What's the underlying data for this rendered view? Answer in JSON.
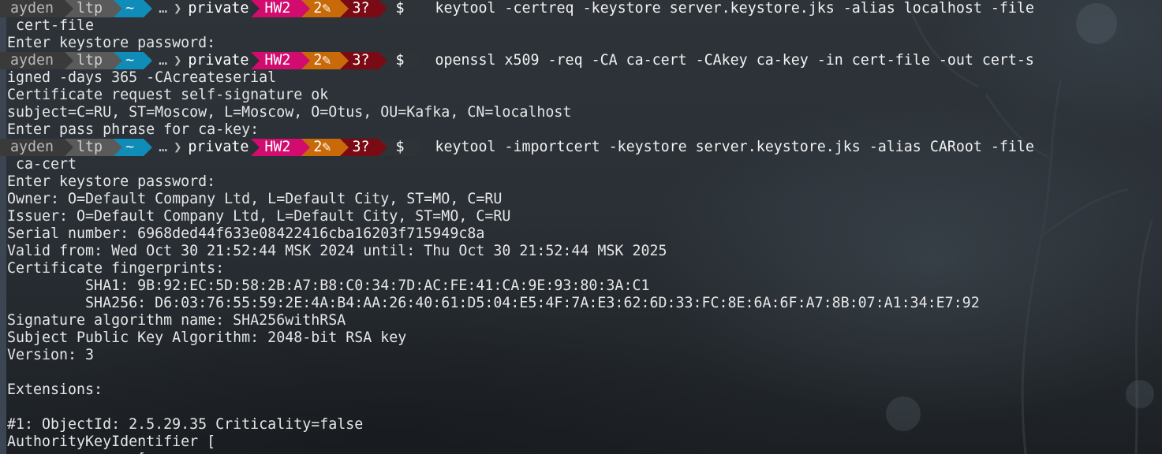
{
  "prompt": {
    "user": "ayden",
    "host": "ltp",
    "home": "~",
    "ellipsis": "…",
    "directory": "private",
    "branch": "HW2",
    "modified": "2✎",
    "untracked": "3?",
    "symbol": "$",
    "icons": {
      "separator": "chevron-right-icon",
      "modified": "pencil-icon"
    }
  },
  "lines": [
    {
      "type": "prompt",
      "command": "keytool -certreq -keystore server.keystore.jks -alias localhost -file"
    },
    {
      "type": "out",
      "text": " cert-file"
    },
    {
      "type": "out",
      "text": "Enter keystore password:"
    },
    {
      "type": "prompt",
      "command": "openssl x509 -req -CA ca-cert -CAkey ca-key -in cert-file -out cert-s"
    },
    {
      "type": "out",
      "text": "igned -days 365 -CAcreateserial"
    },
    {
      "type": "out",
      "text": "Certificate request self-signature ok"
    },
    {
      "type": "out",
      "text": "subject=C=RU, ST=Moscow, L=Moscow, O=Otus, OU=Kafka, CN=localhost"
    },
    {
      "type": "out",
      "text": "Enter pass phrase for ca-key:"
    },
    {
      "type": "prompt",
      "command": "keytool -importcert -keystore server.keystore.jks -alias CARoot -file"
    },
    {
      "type": "out",
      "text": " ca-cert"
    },
    {
      "type": "out",
      "text": "Enter keystore password:"
    },
    {
      "type": "out",
      "text": "Owner: O=Default Company Ltd, L=Default City, ST=MO, C=RU"
    },
    {
      "type": "out",
      "text": "Issuer: O=Default Company Ltd, L=Default City, ST=MO, C=RU"
    },
    {
      "type": "out",
      "text": "Serial number: 6968ded44f633e08422416cba16203f715949c8a"
    },
    {
      "type": "out",
      "text": "Valid from: Wed Oct 30 21:52:44 MSK 2024 until: Thu Oct 30 21:52:44 MSK 2025"
    },
    {
      "type": "out",
      "text": "Certificate fingerprints:"
    },
    {
      "type": "out",
      "text": "         SHA1: 9B:92:EC:5D:58:2B:A7:B8:C0:34:7D:AC:FE:41:CA:9E:93:80:3A:C1"
    },
    {
      "type": "out",
      "text": "         SHA256: D6:03:76:55:59:2E:4A:B4:AA:26:40:61:D5:04:E5:4F:7A:E3:62:6D:33:FC:8E:6A:6F:A7:8B:07:A1:34:E7:92"
    },
    {
      "type": "out",
      "text": "Signature algorithm name: SHA256withRSA"
    },
    {
      "type": "out",
      "text": "Subject Public Key Algorithm: 2048-bit RSA key"
    },
    {
      "type": "out",
      "text": "Version: 3"
    },
    {
      "type": "out",
      "text": ""
    },
    {
      "type": "out",
      "text": "Extensions:"
    },
    {
      "type": "out",
      "text": ""
    },
    {
      "type": "out",
      "text": "#1: ObjectId: 2.5.29.35 Criticality=false"
    },
    {
      "type": "out",
      "text": "AuthorityKeyIdentifier ["
    },
    {
      "type": "out",
      "text": "               ["
    }
  ],
  "colors": {
    "user_bg": "#3a3a3a",
    "host_bg": "#5a5a5a",
    "home_bg": "#0f8db8",
    "branch_bg": "#d20c6e",
    "modified_bg": "#c96a0a",
    "untracked_bg": "#7a0b14",
    "text": "#e6e6e6"
  }
}
